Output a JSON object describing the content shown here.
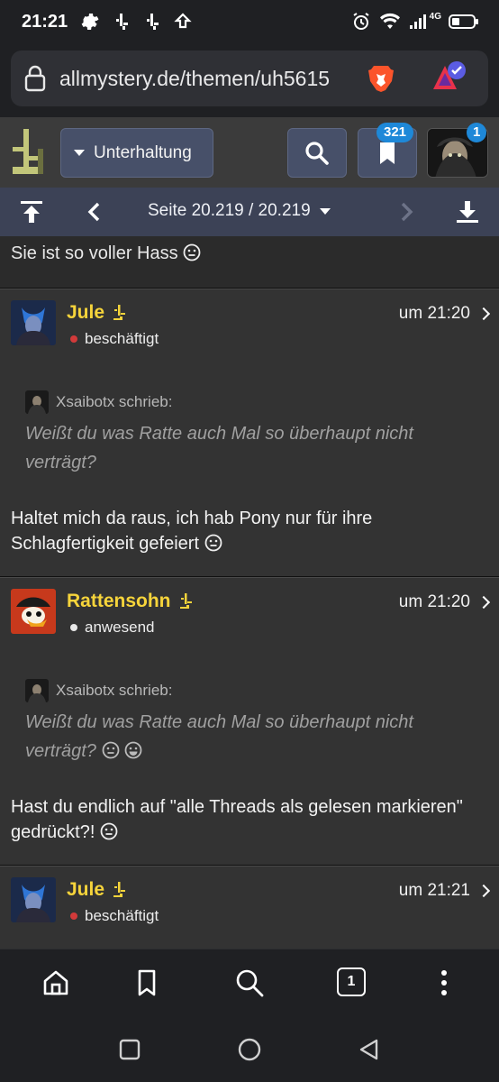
{
  "status_bar": {
    "time": "21:21",
    "network": "4G"
  },
  "browser": {
    "url": "allmystery.de/themen/uh5615"
  },
  "header": {
    "category": "Unterhaltung",
    "bookmark_badge": "321",
    "avatar_badge": "1"
  },
  "pagination": {
    "page_label": "Seite 20.219 / 20.219"
  },
  "posts": {
    "prev_tail": "Sie ist so voller Hass",
    "p1": {
      "user": "Jule",
      "status": "beschäftigt",
      "status_color": "#d23a3a",
      "time": "um 21:20",
      "quote_author": "Xsaibotx schrieb:",
      "quote_text": "Weißt du was Ratte auch Mal so überhaupt nicht verträgt?",
      "text": "Haltet mich da raus, ich hab Pony nur für ihre Schlagfertigkeit gefeiert"
    },
    "p2": {
      "user": "Rattensohn",
      "status": "anwesend",
      "status_color": "#e8e8e8",
      "time": "um 21:20",
      "quote_author": "Xsaibotx schrieb:",
      "quote_text": "Weißt du was Ratte auch Mal so überhaupt nicht verträgt?",
      "text": "Hast du endlich auf \"alle Threads als gelesen markieren\" gedrückt?!"
    },
    "p3": {
      "user": "Jule",
      "status": "beschäftigt",
      "status_color": "#d23a3a",
      "time": "um 21:21"
    }
  },
  "bottom_nav": {
    "tab_count": "1"
  },
  "colors": {
    "accent_username": "#f6d43b",
    "badge": "#1e88d8",
    "pagebar": "#3c4256"
  }
}
